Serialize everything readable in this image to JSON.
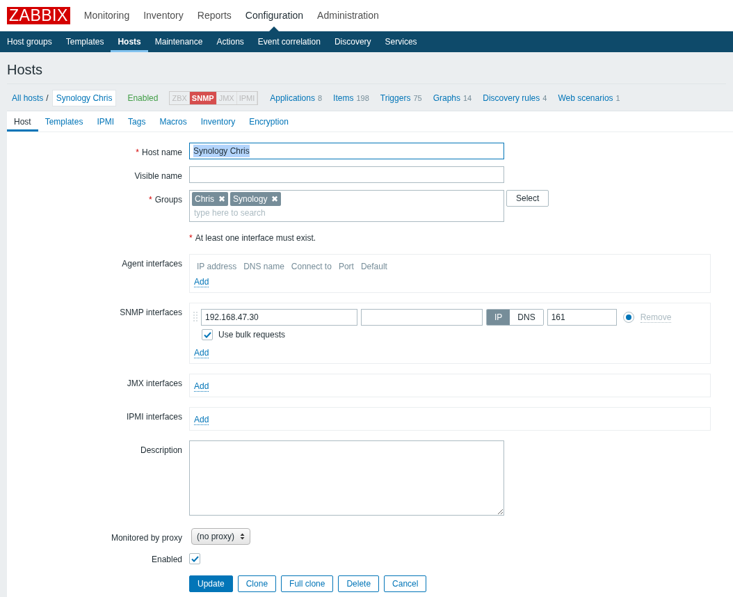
{
  "logo": "ZABBIX",
  "main_menu": [
    {
      "label": "Monitoring",
      "selected": false
    },
    {
      "label": "Inventory",
      "selected": false
    },
    {
      "label": "Reports",
      "selected": false
    },
    {
      "label": "Configuration",
      "selected": true
    },
    {
      "label": "Administration",
      "selected": false
    }
  ],
  "sub_menu": [
    {
      "label": "Host groups",
      "selected": false
    },
    {
      "label": "Templates",
      "selected": false
    },
    {
      "label": "Hosts",
      "selected": true
    },
    {
      "label": "Maintenance",
      "selected": false
    },
    {
      "label": "Actions",
      "selected": false
    },
    {
      "label": "Event correlation",
      "selected": false
    },
    {
      "label": "Discovery",
      "selected": false
    },
    {
      "label": "Services",
      "selected": false
    }
  ],
  "page_title": "Hosts",
  "breadcrumb": {
    "all": "All hosts",
    "separator": "/",
    "current": "Synology Chris"
  },
  "status": "Enabled",
  "availability": [
    {
      "label": "ZBX",
      "on": false
    },
    {
      "label": "SNMP",
      "on": true
    },
    {
      "label": "JMX",
      "on": false
    },
    {
      "label": "IPMI",
      "on": false
    }
  ],
  "host_links": [
    {
      "label": "Applications",
      "count": "8"
    },
    {
      "label": "Items",
      "count": "198"
    },
    {
      "label": "Triggers",
      "count": "75"
    },
    {
      "label": "Graphs",
      "count": "14"
    },
    {
      "label": "Discovery rules",
      "count": "4"
    },
    {
      "label": "Web scenarios",
      "count": "1"
    }
  ],
  "tabs": [
    {
      "label": "Host",
      "selected": true
    },
    {
      "label": "Templates",
      "selected": false
    },
    {
      "label": "IPMI",
      "selected": false
    },
    {
      "label": "Tags",
      "selected": false
    },
    {
      "label": "Macros",
      "selected": false
    },
    {
      "label": "Inventory",
      "selected": false
    },
    {
      "label": "Encryption",
      "selected": false
    }
  ],
  "form": {
    "host_name": {
      "required_mark": "*",
      "label": "Host name",
      "value": "Synology Chris",
      "highlighted": true
    },
    "visible_name": {
      "label": "Visible name"
    },
    "groups": {
      "required_mark": "*",
      "label": "Groups",
      "tags": [
        {
          "label": "Chris",
          "remove": "✖"
        },
        {
          "label": "Synology",
          "remove": "✖"
        }
      ],
      "placeholder": "type here to search",
      "button": "Select"
    },
    "interface_note": {
      "required_mark": "*",
      "text": "At least one interface must exist."
    },
    "interfaces": [
      {
        "label": "Agent interfaces",
        "columns": [
          "IP address",
          "DNS name",
          "Connect to",
          "Port",
          "Default"
        ],
        "add": "Add"
      },
      {
        "label": "SNMP interfaces",
        "rows": [
          {
            "ip": "192.168.47.30",
            "connect": [
              {
                "label": "IP",
                "selected": true
              },
              {
                "label": "DNS",
                "selected": false
              }
            ],
            "port": "161",
            "default": true,
            "remove": "Remove",
            "bulk": {
              "label": "Use bulk requests",
              "checked": true
            }
          }
        ],
        "add": "Add"
      },
      {
        "label": "JMX interfaces",
        "add": "Add"
      },
      {
        "label": "IPMI interfaces",
        "add": "Add"
      }
    ],
    "description": {
      "label": "Description"
    },
    "proxy": {
      "label": "Monitored by proxy",
      "value": "(no proxy)"
    },
    "enabled": {
      "label": "Enabled",
      "checked": true
    },
    "buttons": [
      {
        "label": "Update",
        "primary": true
      },
      {
        "label": "Clone",
        "primary": false
      },
      {
        "label": "Full clone",
        "primary": false
      },
      {
        "label": "Delete",
        "primary": false
      },
      {
        "label": "Cancel",
        "primary": false
      }
    ]
  }
}
